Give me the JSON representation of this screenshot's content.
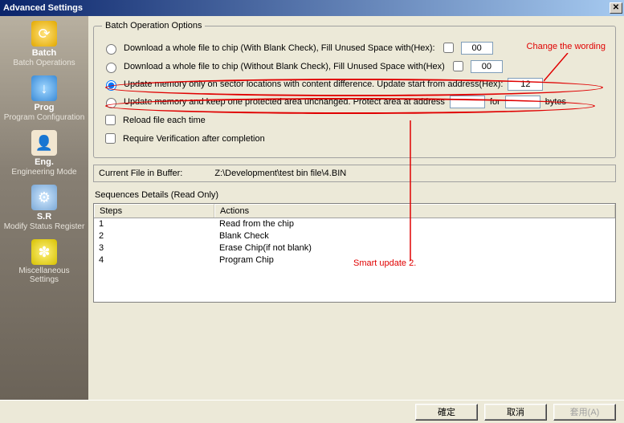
{
  "window": {
    "title": "Advanced Settings"
  },
  "sidebar": {
    "items": [
      {
        "label": "Batch",
        "sub": "Batch Operations",
        "glyph": "⟳"
      },
      {
        "label": "Prog",
        "sub": "Program Configuration",
        "glyph": "↓"
      },
      {
        "label": "Eng.",
        "sub": "Engineering Mode",
        "glyph": "👤"
      },
      {
        "label": "S.R",
        "sub": "Modify Status Register",
        "glyph": "⚙"
      },
      {
        "label": "",
        "sub": "Miscellaneous Settings",
        "glyph": "✽"
      }
    ]
  },
  "batch": {
    "legend": "Batch Operation Options",
    "opt1": {
      "label": "Download a whole file to chip (With Blank Check), Fill Unused Space with(Hex):",
      "hex": "00"
    },
    "opt2": {
      "label": "Download a whole file to chip (Without Blank Check), Fill Unused Space with(Hex)",
      "hex": "00"
    },
    "opt3": {
      "label": "Update memory only on sector locations with content difference. Update start from address(Hex):",
      "addr": "12"
    },
    "opt4": {
      "label_a": "Update memory and keep one protected area unchanged. Protect area at address",
      "label_b": "for",
      "label_c": "bytes",
      "addr": "",
      "len": ""
    },
    "reload": "Reload file each time",
    "verify": "Require Verification after completion"
  },
  "annotations": {
    "change_wording": "Change the wording",
    "smart_update": "Smart update 2."
  },
  "file": {
    "label": "Current File in Buffer:",
    "path": "Z:\\Development\\test bin file\\4.BIN"
  },
  "seq": {
    "title": "Sequences Details (Read Only)",
    "cols": {
      "steps": "Steps",
      "actions": "Actions"
    },
    "rows": [
      {
        "step": "1",
        "action": "Read from the chip"
      },
      {
        "step": "2",
        "action": "Blank Check"
      },
      {
        "step": "3",
        "action": "Erase Chip(if not blank)"
      },
      {
        "step": "4",
        "action": "Program Chip"
      }
    ]
  },
  "buttons": {
    "ok": "確定",
    "cancel": "取消",
    "apply": "套用(A)"
  }
}
